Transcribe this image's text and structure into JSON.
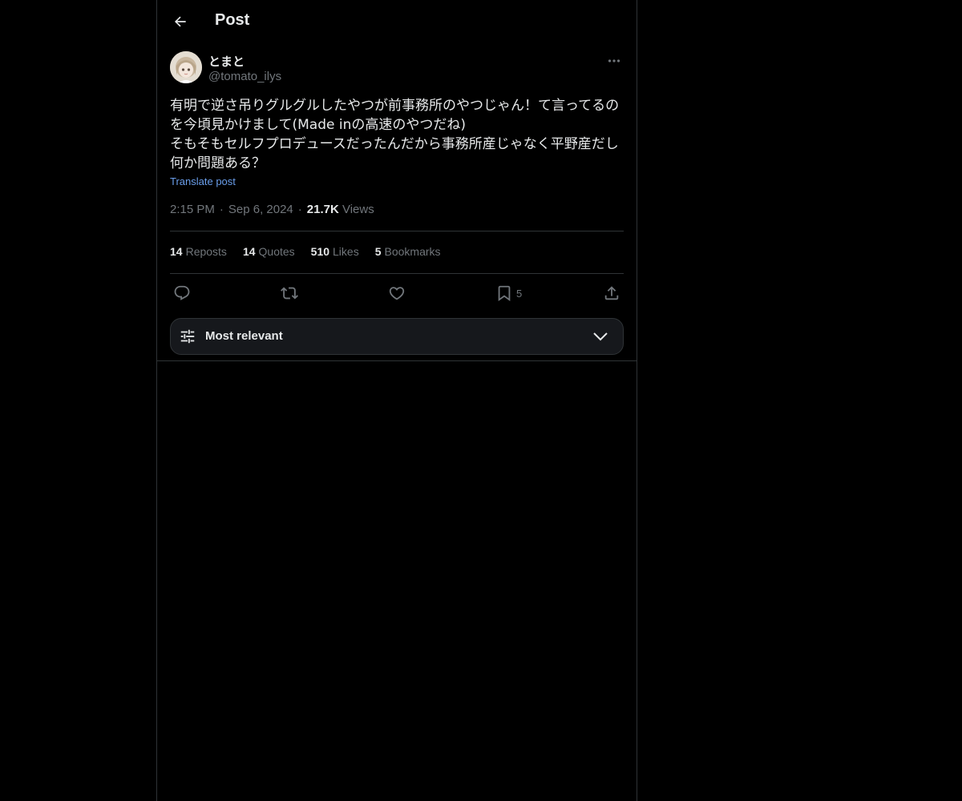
{
  "header": {
    "title": "Post"
  },
  "post": {
    "display_name": "とまと",
    "handle": "@tomato_ilys",
    "text": "有明で逆さ吊りグルグルしたやつが前事務所のやつじゃん！て言ってるのを今頃見かけまして(Made inの高速のやつだね)\nそもそもセルフプロデュースだったんだから事務所産じゃなく平野産だし何か問題ある？",
    "translate_label": "Translate post",
    "time": "2:15 PM",
    "date": "Sep 6, 2024",
    "views_count": "21.7K",
    "views_label": "Views"
  },
  "stats": {
    "reposts_count": "14",
    "reposts_label": "Reposts",
    "quotes_count": "14",
    "quotes_label": "Quotes",
    "likes_count": "510",
    "likes_label": "Likes",
    "bookmarks_count": "5",
    "bookmarks_label": "Bookmarks"
  },
  "actions": {
    "bookmark_count": "5",
    "icons": [
      "reply-icon",
      "repost-icon",
      "like-icon",
      "bookmark-icon",
      "share-icon"
    ]
  },
  "sort": {
    "label": "Most relevant"
  },
  "colors": {
    "background": "#000000",
    "text": "#e7e9ea",
    "muted": "#71767b",
    "link": "#6a9eeb",
    "border": "#2f3336"
  }
}
